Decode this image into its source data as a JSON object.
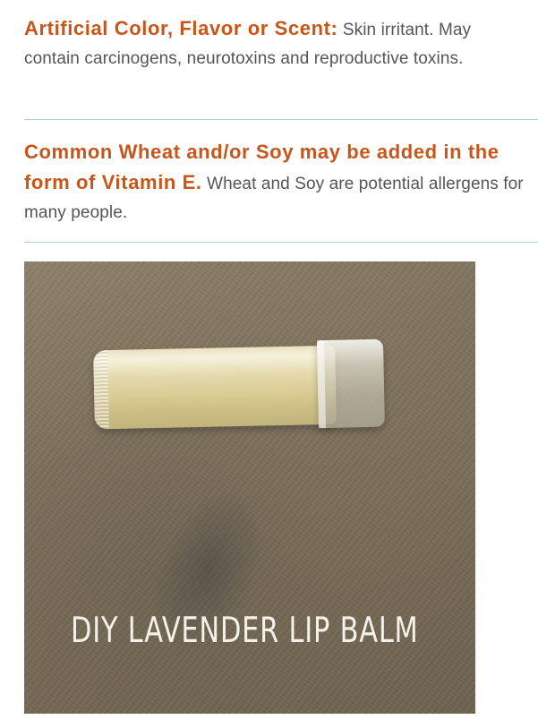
{
  "sections": [
    {
      "heading": "Artificial Color, Flavor or Scent:",
      "body": "Skin irritant. May contain carcinogens, neurotoxins and reproductive toxins."
    },
    {
      "heading": "Common Wheat and/or Soy may be added in the form of Vitamin E.",
      "body": "Wheat and Soy are potential allergens for many people."
    }
  ],
  "photo": {
    "caption": "DIY LAVENDER LIP BALM"
  },
  "colors": {
    "heading": "#c8551a",
    "body_text": "#555555",
    "divider": "#a9d3d3"
  }
}
